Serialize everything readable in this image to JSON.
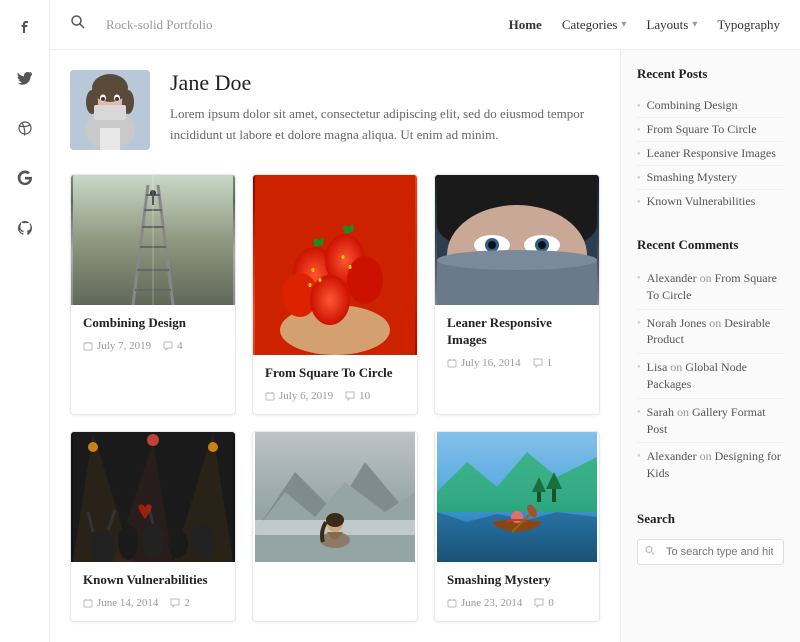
{
  "site": {
    "title": "Rock-solid Portfolio"
  },
  "nav": {
    "home": "Home",
    "categories": "Categories",
    "layouts": "Layouts",
    "typography": "Typography"
  },
  "author": {
    "name": "Jane Doe",
    "bio": "Lorem ipsum dolor sit amet, consectetur adipiscing elit, sed do eiusmod tempor incididunt ut labore et dolore magna aliqua. Ut enim ad minim."
  },
  "posts": [
    {
      "id": 1,
      "title": "Combining Design",
      "date": "July 7, 2019",
      "comments": "4",
      "image_type": "railroad"
    },
    {
      "id": 2,
      "title": "From Square To Circle",
      "date": "July 6, 2019",
      "comments": "10",
      "image_type": "strawberries"
    },
    {
      "id": 3,
      "title": "Leaner Responsive Images",
      "date": "July 16, 2014",
      "comments": "1",
      "image_type": "eyes"
    },
    {
      "id": 4,
      "title": "Known Vulnerabilities",
      "date": "June 14, 2014",
      "comments": "2",
      "image_type": "concert"
    },
    {
      "id": 5,
      "title": "",
      "date": "",
      "comments": "",
      "image_type": "mountain-girl"
    },
    {
      "id": 6,
      "title": "Smashing Mystery",
      "date": "June 23, 2014",
      "comments": "0",
      "image_type": "canoe"
    }
  ],
  "sidebar": {
    "recent_posts_title": "Recent Posts",
    "recent_posts": [
      "Combining Design",
      "From Square To Circle",
      "Leaner Responsive Images",
      "Smashing Mystery",
      "Known Vulnerabilities"
    ],
    "recent_comments_title": "Recent Comments",
    "recent_comments": [
      {
        "author": "Alexander",
        "action": "on",
        "post": "From Square To Circle"
      },
      {
        "author": "Norah Jones",
        "action": "on",
        "post": "Desirable Product"
      },
      {
        "author": "Lisa",
        "action": "on",
        "post": "Global Node Packages"
      },
      {
        "author": "Sarah",
        "action": "on",
        "post": "Gallery Format Post"
      },
      {
        "author": "Alexander",
        "action": "on",
        "post": "Designing for Kids"
      }
    ],
    "search_title": "Search",
    "search_placeholder": "To search type and hit enter"
  },
  "icons": {
    "search": "🔍",
    "facebook": "f",
    "twitter": "t",
    "dribbble": "◉",
    "google": "G",
    "github": "⊙",
    "calendar": "📅",
    "comment": "💬"
  }
}
